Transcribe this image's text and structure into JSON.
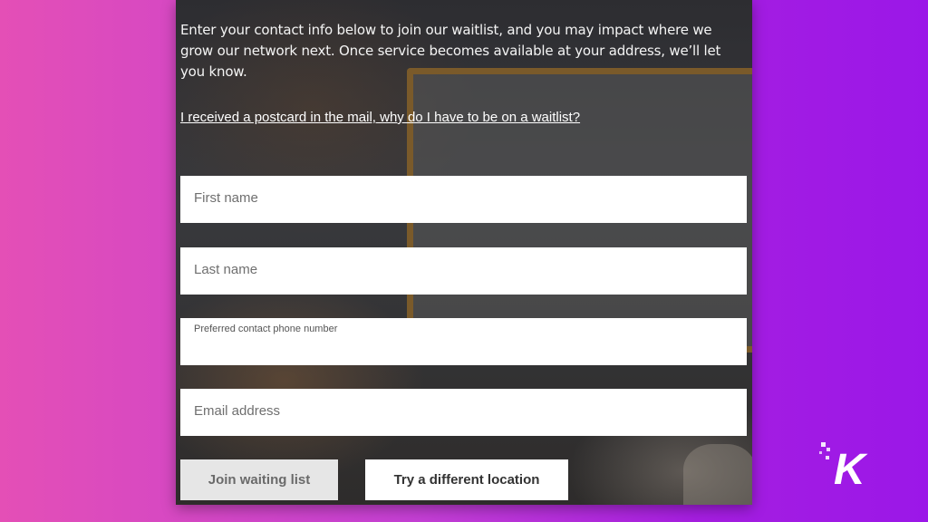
{
  "form": {
    "intro_text": "Enter your contact info below to join our waitlist, and you may impact where we grow our network next. Once service becomes available at your address, we’ll let you know.",
    "postcard_link": "I received a postcard in the mail, why do I have to be on a waitlist?",
    "first_name_placeholder": "First name",
    "last_name_placeholder": "Last name",
    "phone_label": "Preferred contact phone number",
    "email_placeholder": "Email address",
    "join_button": "Join waiting list",
    "try_button": "Try a different location"
  },
  "branding": {
    "logo_letter": "K",
    "logo_icon": "knowtechie-k-logo-icon"
  },
  "colors": {
    "background_left": "#e44fb6",
    "background_right": "#9b17e8",
    "join_button_bg": "#e6e6e6",
    "try_button_bg": "#ffffff"
  }
}
